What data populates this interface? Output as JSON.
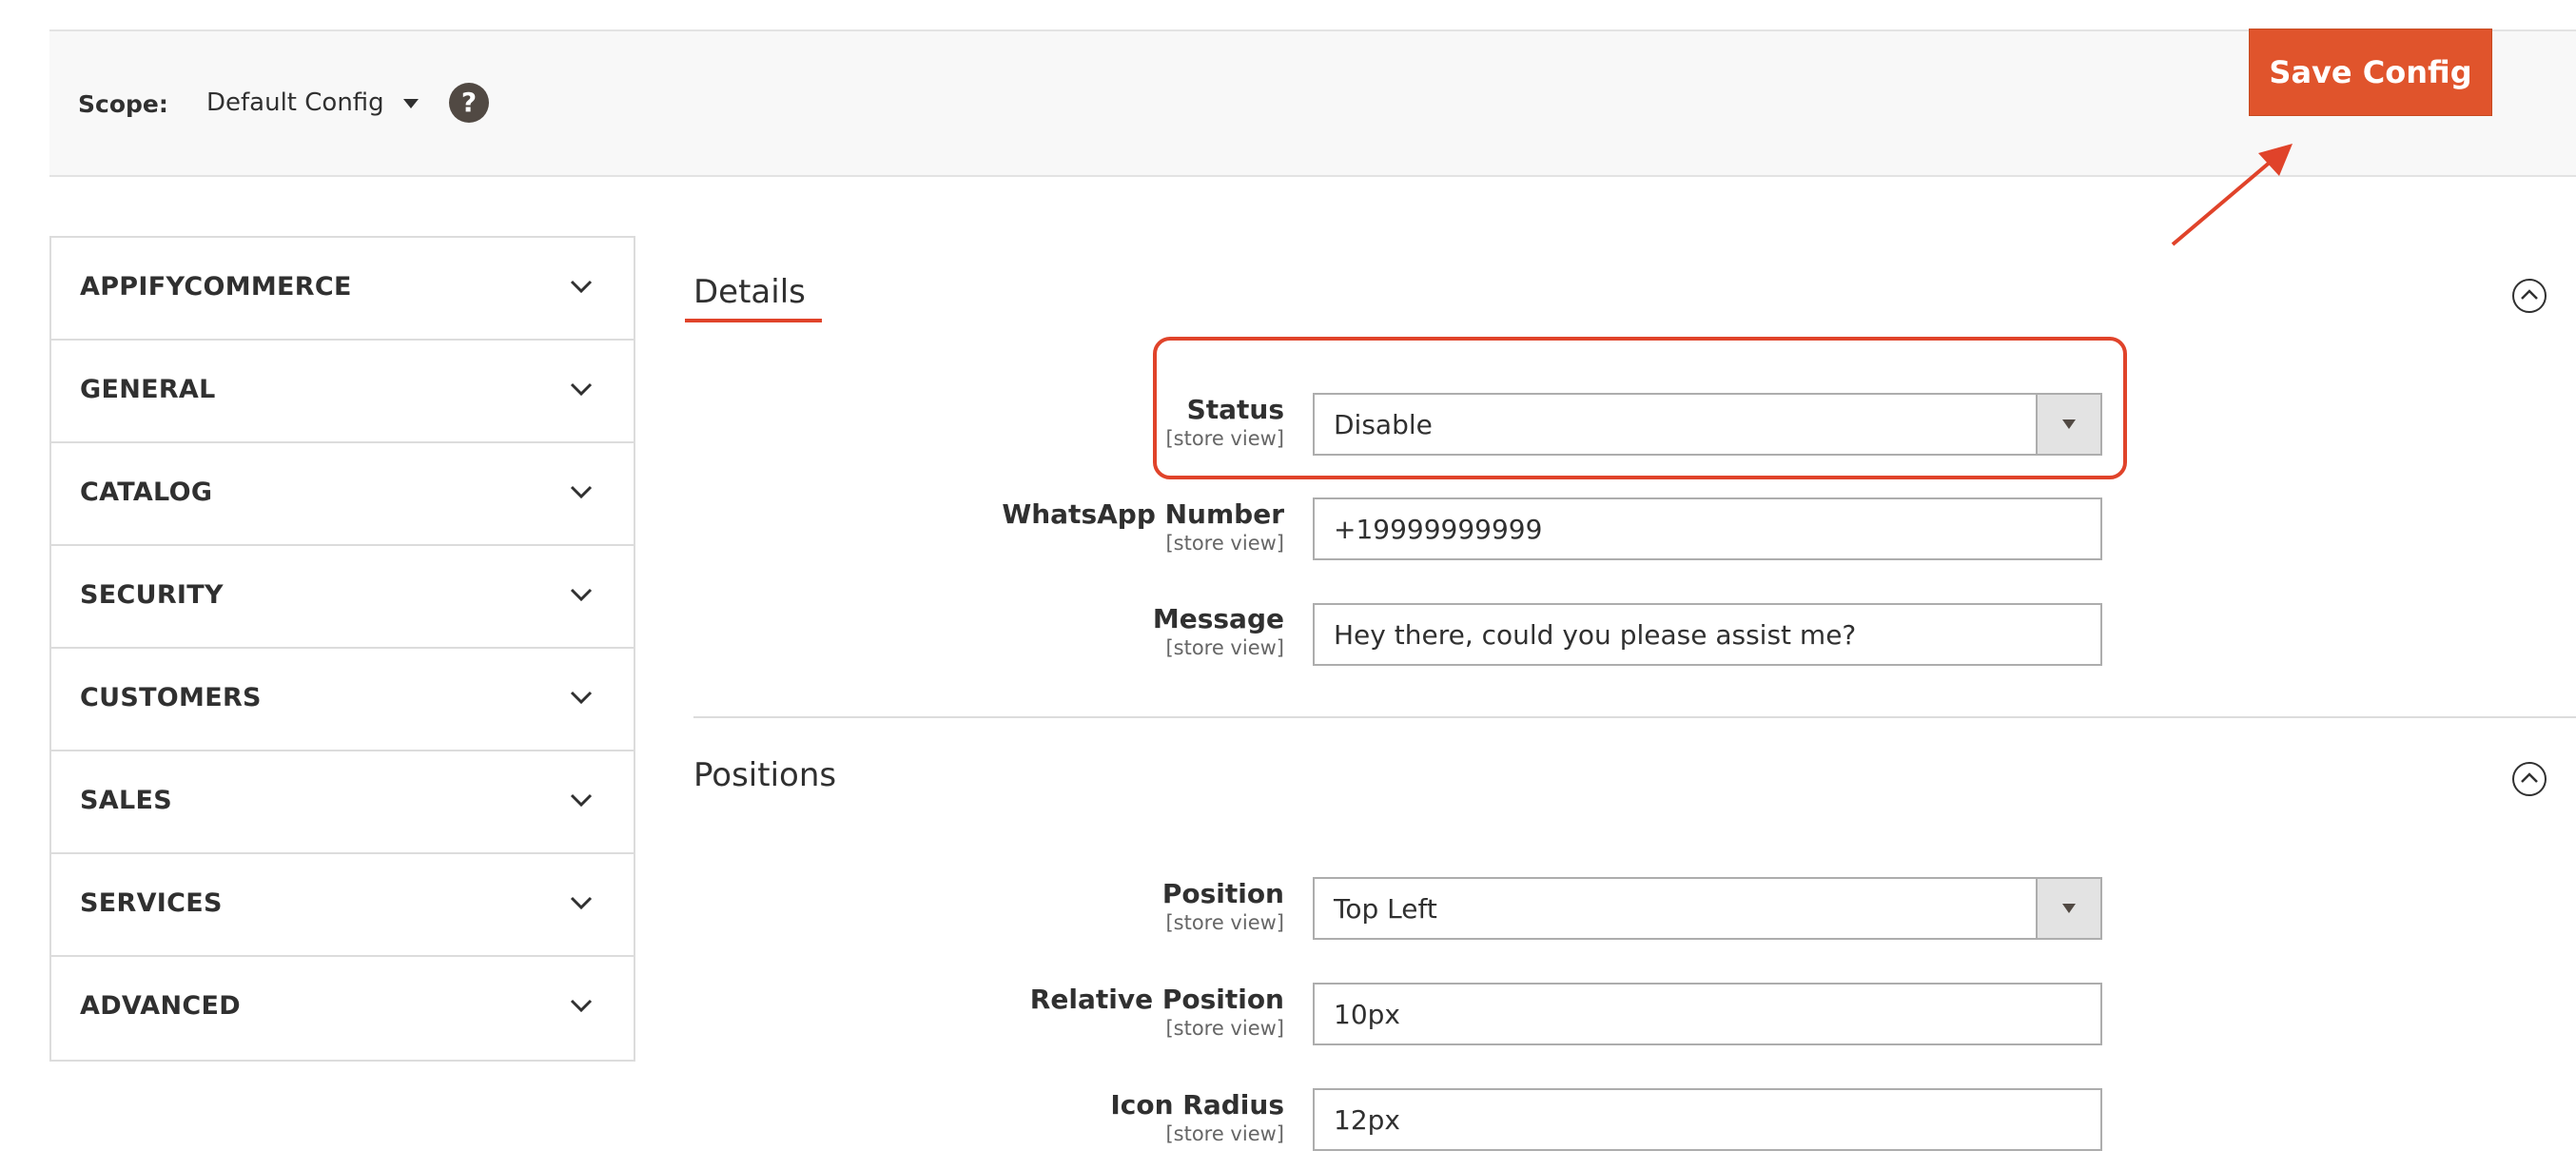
{
  "scope": {
    "label": "Scope:",
    "value": "Default Config",
    "help_symbol": "?"
  },
  "toolbar": {
    "save_label": "Save Config"
  },
  "sidebar": {
    "items": [
      {
        "label": "APPIFYCOMMERCE"
      },
      {
        "label": "GENERAL"
      },
      {
        "label": "CATALOG"
      },
      {
        "label": "SECURITY"
      },
      {
        "label": "CUSTOMERS"
      },
      {
        "label": "SALES"
      },
      {
        "label": "SERVICES"
      },
      {
        "label": "ADVANCED"
      }
    ]
  },
  "details": {
    "title": "Details",
    "status": {
      "label": "Status",
      "scope": "[store view]",
      "value": "Disable"
    },
    "whatsapp": {
      "label": "WhatsApp Number",
      "scope": "[store view]",
      "value": "+19999999999"
    },
    "message": {
      "label": "Message",
      "scope": "[store view]",
      "value": "Hey there, could you please assist me?"
    }
  },
  "positions": {
    "title": "Positions",
    "position": {
      "label": "Position",
      "scope": "[store view]",
      "value": "Top Left"
    },
    "relative": {
      "label": "Relative Position",
      "scope": "[store view]",
      "value": "10px"
    },
    "radius": {
      "label": "Icon Radius",
      "scope": "[store view]",
      "value": "12px"
    }
  },
  "colors": {
    "accent": "#e0542c",
    "annotation": "#e0432a"
  }
}
